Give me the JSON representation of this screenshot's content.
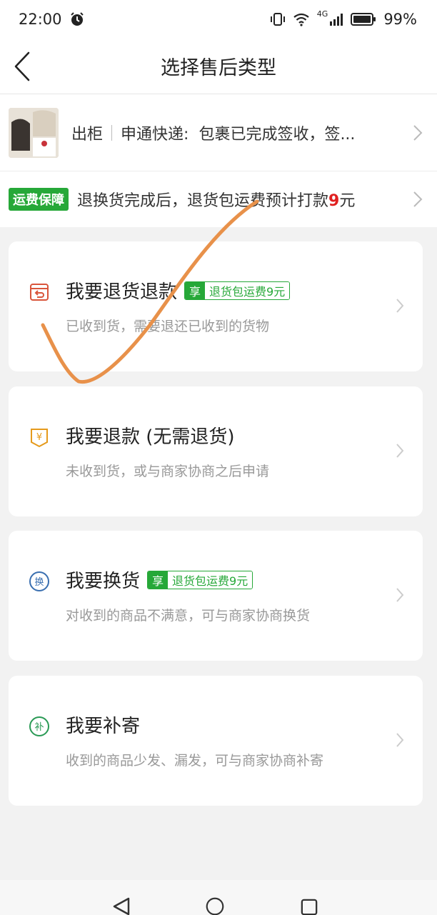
{
  "status_bar": {
    "time": "22:00",
    "network": "4G",
    "battery": "99%"
  },
  "header": {
    "title": "选择售后类型"
  },
  "order": {
    "status": "出柜",
    "courier": "申通快递:",
    "tracking": "包裹已完成签收，签..."
  },
  "shipping": {
    "badge": "运费保障",
    "text": "退换货完成后，退货包运费预计打款",
    "amount": "9",
    "unit": "元"
  },
  "options": [
    {
      "title": "我要退货退款",
      "perk_tag": "享",
      "perk_text": "退货包运费9元",
      "subtitle": "已收到货，需要退还已收到的货物",
      "icon": "return-box-icon",
      "icon_color": "#d9553b"
    },
    {
      "title": "我要退款 (无需退货)",
      "subtitle": "未收到货，或与商家协商之后申请",
      "icon": "refund-yen-icon",
      "icon_color": "#e59a1c"
    },
    {
      "title": "我要换货",
      "perk_tag": "享",
      "perk_text": "退货包运费9元",
      "subtitle": "对收到的商品不满意，可与商家协商换货",
      "icon": "exchange-icon",
      "icon_glyph": "换",
      "icon_color": "#3a6fb0"
    },
    {
      "title": "我要补寄",
      "subtitle": "收到的商品少发、漏发，可与商家协商补寄",
      "icon": "resend-icon",
      "icon_glyph": "补",
      "icon_color": "#2a9a55"
    }
  ],
  "colors": {
    "accent_green": "#26a838",
    "annotation_stroke": "#e8914a",
    "price_red": "#e02020"
  }
}
